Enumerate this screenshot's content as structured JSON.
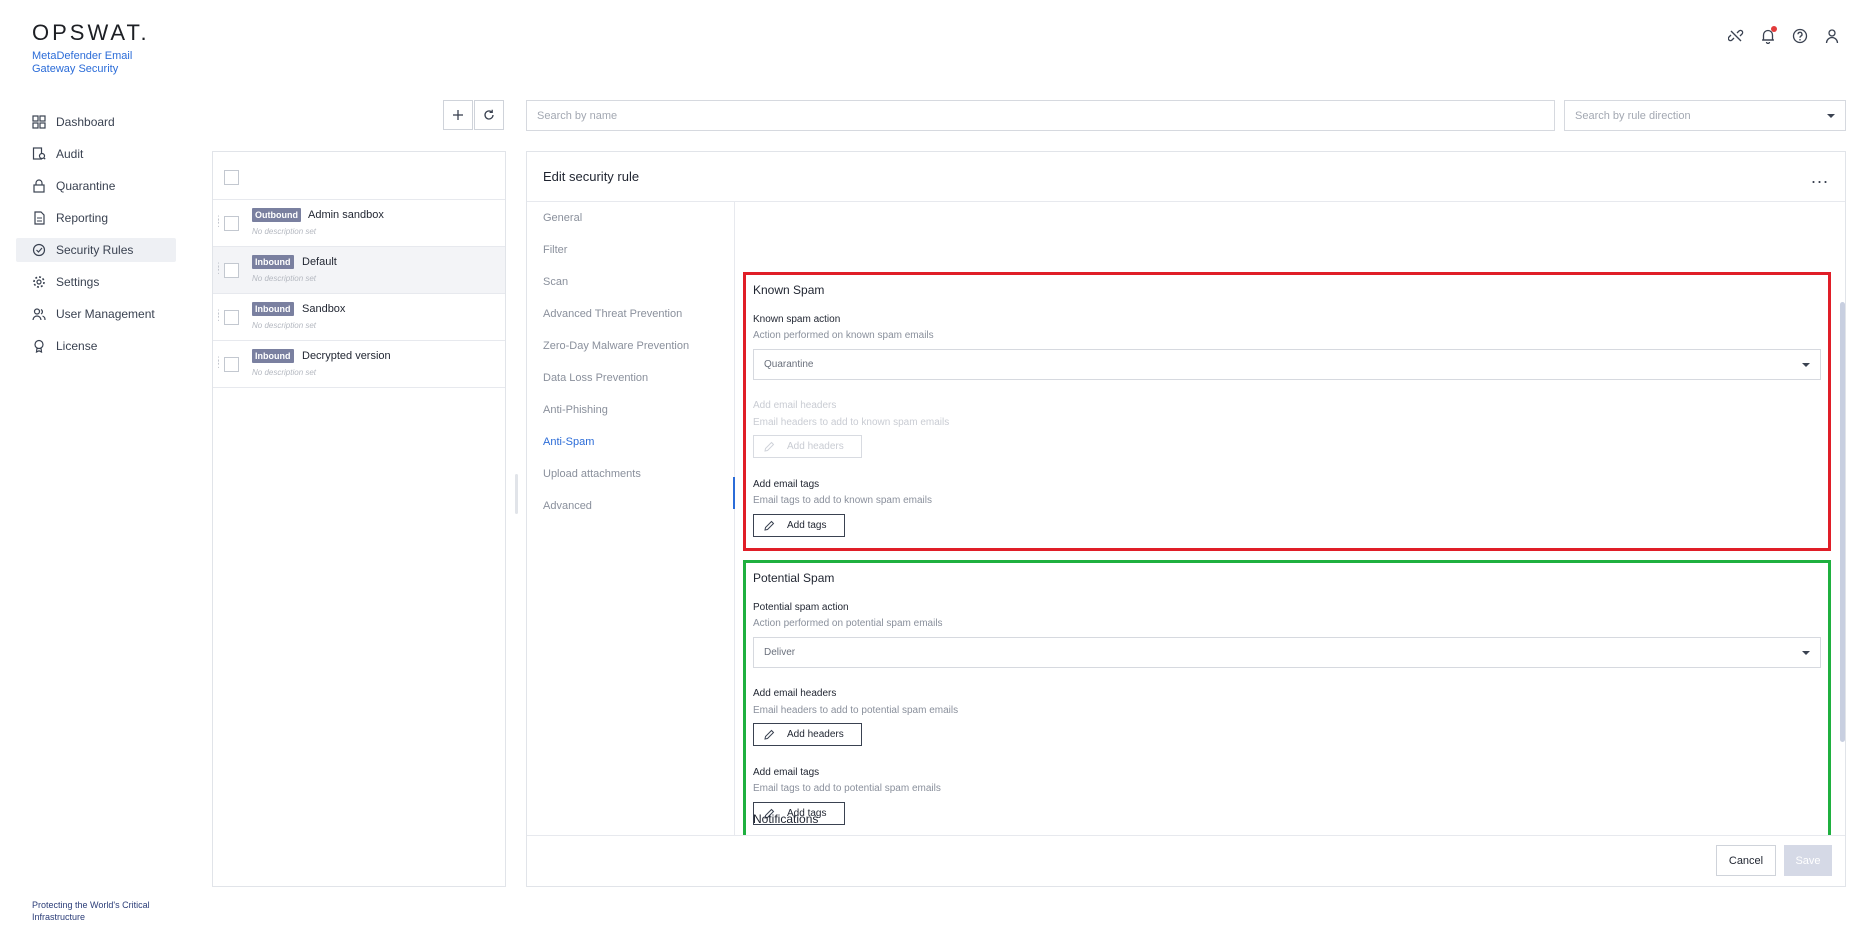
{
  "app": {
    "brand": "OPSWAT.",
    "product": "MetaDefender Email Gateway Security",
    "footer": "Protecting the World's Critical Infrastructure"
  },
  "sidebar": {
    "items": [
      {
        "label": "Dashboard",
        "icon": "dashboard-icon",
        "active": false
      },
      {
        "label": "Audit",
        "icon": "audit-icon",
        "active": false
      },
      {
        "label": "Quarantine",
        "icon": "lock-icon",
        "active": false
      },
      {
        "label": "Reporting",
        "icon": "document-icon",
        "active": false
      },
      {
        "label": "Security Rules",
        "icon": "shield-check-icon",
        "active": true
      },
      {
        "label": "Settings",
        "icon": "gear-icon",
        "active": false
      },
      {
        "label": "User Management",
        "icon": "users-icon",
        "active": false
      },
      {
        "label": "License",
        "icon": "license-icon",
        "active": false
      }
    ]
  },
  "search": {
    "name_placeholder": "Search by name",
    "direction_placeholder": "Search by rule direction"
  },
  "rules": [
    {
      "direction": "Outbound",
      "name": "Admin sandbox",
      "description": "No description set"
    },
    {
      "direction": "Inbound",
      "name": "Default",
      "description": "No description set"
    },
    {
      "direction": "Inbound",
      "name": "Sandbox",
      "description": "No description set"
    },
    {
      "direction": "Inbound",
      "name": "Decrypted version",
      "description": "No description set"
    }
  ],
  "editor": {
    "title": "Edit security rule",
    "menu": "...",
    "sections": [
      "General",
      "Filter",
      "Scan",
      "Advanced Threat Prevention",
      "Zero-Day Malware Prevention",
      "Data Loss Prevention",
      "Anti-Phishing",
      "Anti-Spam",
      "Upload attachments",
      "Advanced"
    ],
    "active_section": "Anti-Spam",
    "known_spam": {
      "title": "Known Spam",
      "action_label": "Known spam action",
      "action_help": "Action performed on known spam emails",
      "action_value": "Quarantine",
      "headers_label": "Add email headers",
      "headers_help": "Email headers to add to known spam emails",
      "headers_button": "Add headers",
      "tags_label": "Add email tags",
      "tags_help": "Email tags to add to known spam emails",
      "tags_button": "Add tags"
    },
    "potential_spam": {
      "title": "Potential Spam",
      "action_label": "Potential spam action",
      "action_help": "Action performed on potential spam emails",
      "action_value": "Deliver",
      "headers_label": "Add email headers",
      "headers_help": "Email headers to add to potential spam emails",
      "headers_button": "Add headers",
      "tags_label": "Add email tags",
      "tags_help": "Email tags to add to potential spam emails",
      "tags_button": "Add tags"
    },
    "notifications_title": "Notifications",
    "cancel_label": "Cancel",
    "save_label": "Save"
  },
  "colors": {
    "accent": "#2b6cd8",
    "known_spam_outline": "#e01e28",
    "potential_spam_outline": "#1fb03f",
    "badge": "#7a80a0"
  }
}
